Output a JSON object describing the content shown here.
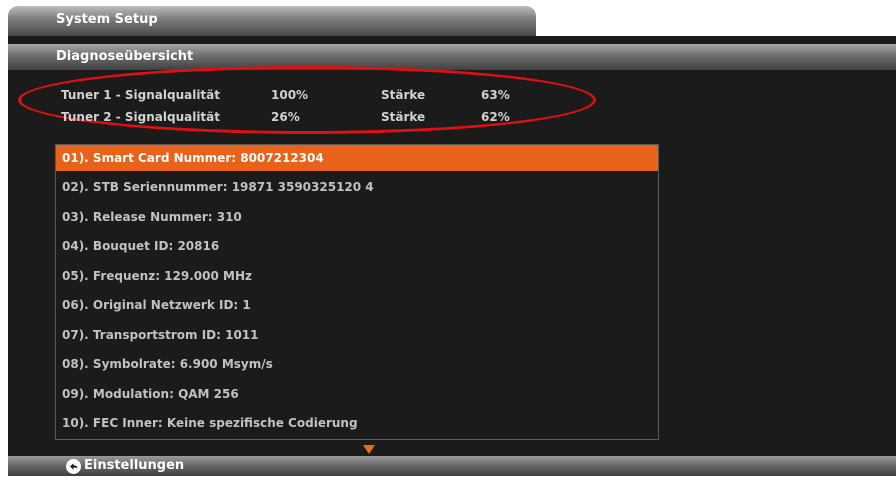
{
  "window": {
    "title": "System Setup"
  },
  "header": {
    "title": "Diagnoseübersicht"
  },
  "tuners": [
    {
      "label": "Tuner 1 - Signalqualität",
      "quality": "100%",
      "strength_label": "Stärke",
      "strength": "63%"
    },
    {
      "label": "Tuner 2 - Signalqualität",
      "quality": "26%",
      "strength_label": "Stärke",
      "strength": "62%"
    }
  ],
  "list": {
    "selected_index": 0,
    "items": [
      "01). Smart Card Nummer: 8007212304",
      "02). STB Seriennummer: 19871 3590325120 4",
      "03). Release Nummer: 310",
      "04). Bouquet ID: 20816",
      "05). Frequenz: 129.000 MHz",
      "06). Original Netzwerk ID: 1",
      "07). Transportstrom ID: 1011",
      "08). Symbolrate: 6.900 Msym/s",
      "09). Modulation: QAM 256",
      "10). FEC Inner: Keine spezifische Codierung"
    ]
  },
  "footer": {
    "back_icon": "back-arrow-icon",
    "label": "Einstellungen"
  },
  "colors": {
    "highlight": "#e8621a",
    "annotation": "#e01010",
    "background": "#1b1b1b"
  }
}
